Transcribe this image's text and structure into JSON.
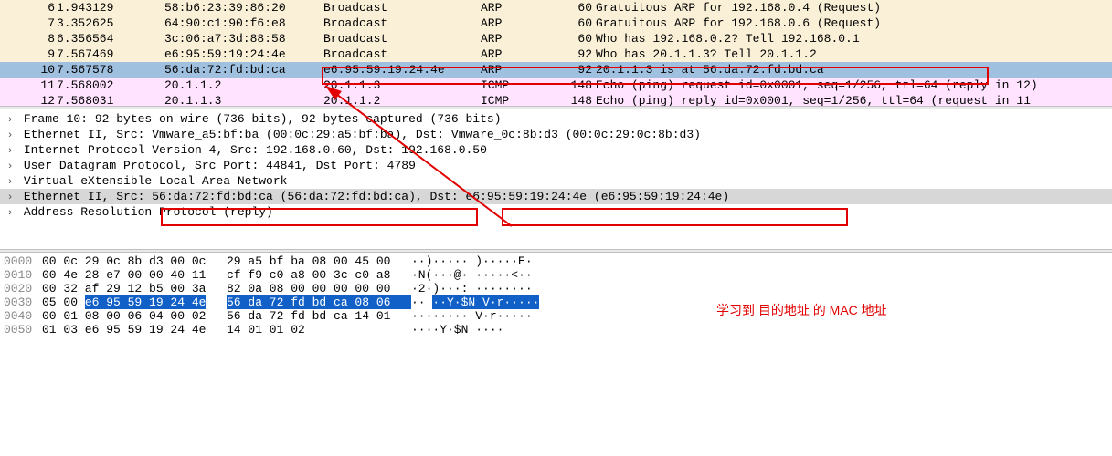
{
  "packet_list": [
    {
      "no": 6,
      "time": "1.943129",
      "src": "58:b6:23:39:86:20",
      "dst": "Broadcast",
      "proto": "ARP",
      "len": 60,
      "info": "Gratuitous ARP for 192.168.0.4 (Request)",
      "style": "row-yellow"
    },
    {
      "no": 7,
      "time": "3.352625",
      "src": "64:90:c1:90:f6:e8",
      "dst": "Broadcast",
      "proto": "ARP",
      "len": 60,
      "info": "Gratuitous ARP for 192.168.0.6 (Request)",
      "style": "row-yellow"
    },
    {
      "no": 8,
      "time": "6.356564",
      "src": "3c:06:a7:3d:88:58",
      "dst": "Broadcast",
      "proto": "ARP",
      "len": 60,
      "info": "Who has 192.168.0.2? Tell 192.168.0.1",
      "style": "row-yellow"
    },
    {
      "no": 9,
      "time": "7.567469",
      "src": "e6:95:59:19:24:4e",
      "dst": "Broadcast",
      "proto": "ARP",
      "len": 92,
      "info": "Who has 20.1.1.3? Tell 20.1.1.2",
      "style": "row-yellow"
    },
    {
      "no": 10,
      "time": "7.567578",
      "src": "56:da:72:fd:bd:ca",
      "dst": "e6:95:59:19:24:4e",
      "proto": "ARP",
      "len": 92,
      "info": "20.1.1.3 is at 56:da:72:fd:bd:ca",
      "style": "row-sel"
    },
    {
      "no": 11,
      "time": "7.568002",
      "src": "20.1.1.2",
      "dst": "20.1.1.3",
      "proto": "ICMP",
      "len": 148,
      "info": "Echo (ping) request  id=0x0001, seq=1/256, ttl=64 (reply in 12)",
      "style": "row-pink"
    },
    {
      "no": 12,
      "time": "7.568031",
      "src": "20.1.1.3",
      "dst": "20.1.1.2",
      "proto": "ICMP",
      "len": 148,
      "info": "Echo (ping) reply    id=0x0001, seq=1/256, ttl=64 (request in 11",
      "style": "row-pink"
    }
  ],
  "tree": [
    {
      "caret": "›",
      "text": "Frame 10: 92 bytes on wire (736 bits), 92 bytes captured (736 bits)",
      "sel": false
    },
    {
      "caret": "›",
      "text": "Ethernet II, Src: Vmware_a5:bf:ba (00:0c:29:a5:bf:ba), Dst: Vmware_0c:8b:d3 (00:0c:29:0c:8b:d3)",
      "sel": false
    },
    {
      "caret": "›",
      "text": "Internet Protocol Version 4, Src: 192.168.0.60, Dst: 192.168.0.50",
      "sel": false
    },
    {
      "caret": "›",
      "text": "User Datagram Protocol, Src Port: 44841, Dst Port: 4789",
      "sel": false
    },
    {
      "caret": "›",
      "text": "Virtual eXtensible Local Area Network",
      "sel": false
    },
    {
      "caret": "›",
      "text": "Ethernet II, Src: 56:da:72:fd:bd:ca (56:da:72:fd:bd:ca), Dst: e6:95:59:19:24:4e (e6:95:59:19:24:4e)",
      "sel": true
    },
    {
      "caret": "›",
      "text": "Address Resolution Protocol (reply)",
      "sel": false
    }
  ],
  "hex": [
    {
      "off": "0000",
      "b1": "00 0c 29 0c 8b d3 00 0c",
      "b2": "29 a5 bf ba 08 00 45 00",
      "a": "··)····· )·····E·",
      "sel": false
    },
    {
      "off": "0010",
      "b1": "00 4e 28 e7 00 00 40 11",
      "b2": "cf f9 c0 a8 00 3c c0 a8",
      "a": "·N(···@· ·····<··",
      "sel": false
    },
    {
      "off": "0020",
      "b1": "00 32 af 29 12 b5 00 3a",
      "b2": "82 0a 08 00 00 00 00 00",
      "a": "·2·)···: ········",
      "sel": false
    },
    {
      "off": "0030",
      "b1": "05 00 ",
      "b1s": "e6 95 59 19 24 4e",
      "b2s": "56 da 72 fd bd ca 08 06",
      "a": "·· ··Y·$N V·r·····",
      "sel": true
    },
    {
      "off": "0040",
      "b1": "00 01 08 00 06 04 00 02",
      "b2": "56 da 72 fd bd ca 14 01",
      "a": "········ V·r·····",
      "sel": false
    },
    {
      "off": "0050",
      "b1": "01 03 e6 95 59 19 24 4e",
      "b2": "14 01 01 02",
      "a": "····Y·$N ····",
      "sel": false
    }
  ],
  "annotation": "学习到 目的地址 的 MAC 地址"
}
